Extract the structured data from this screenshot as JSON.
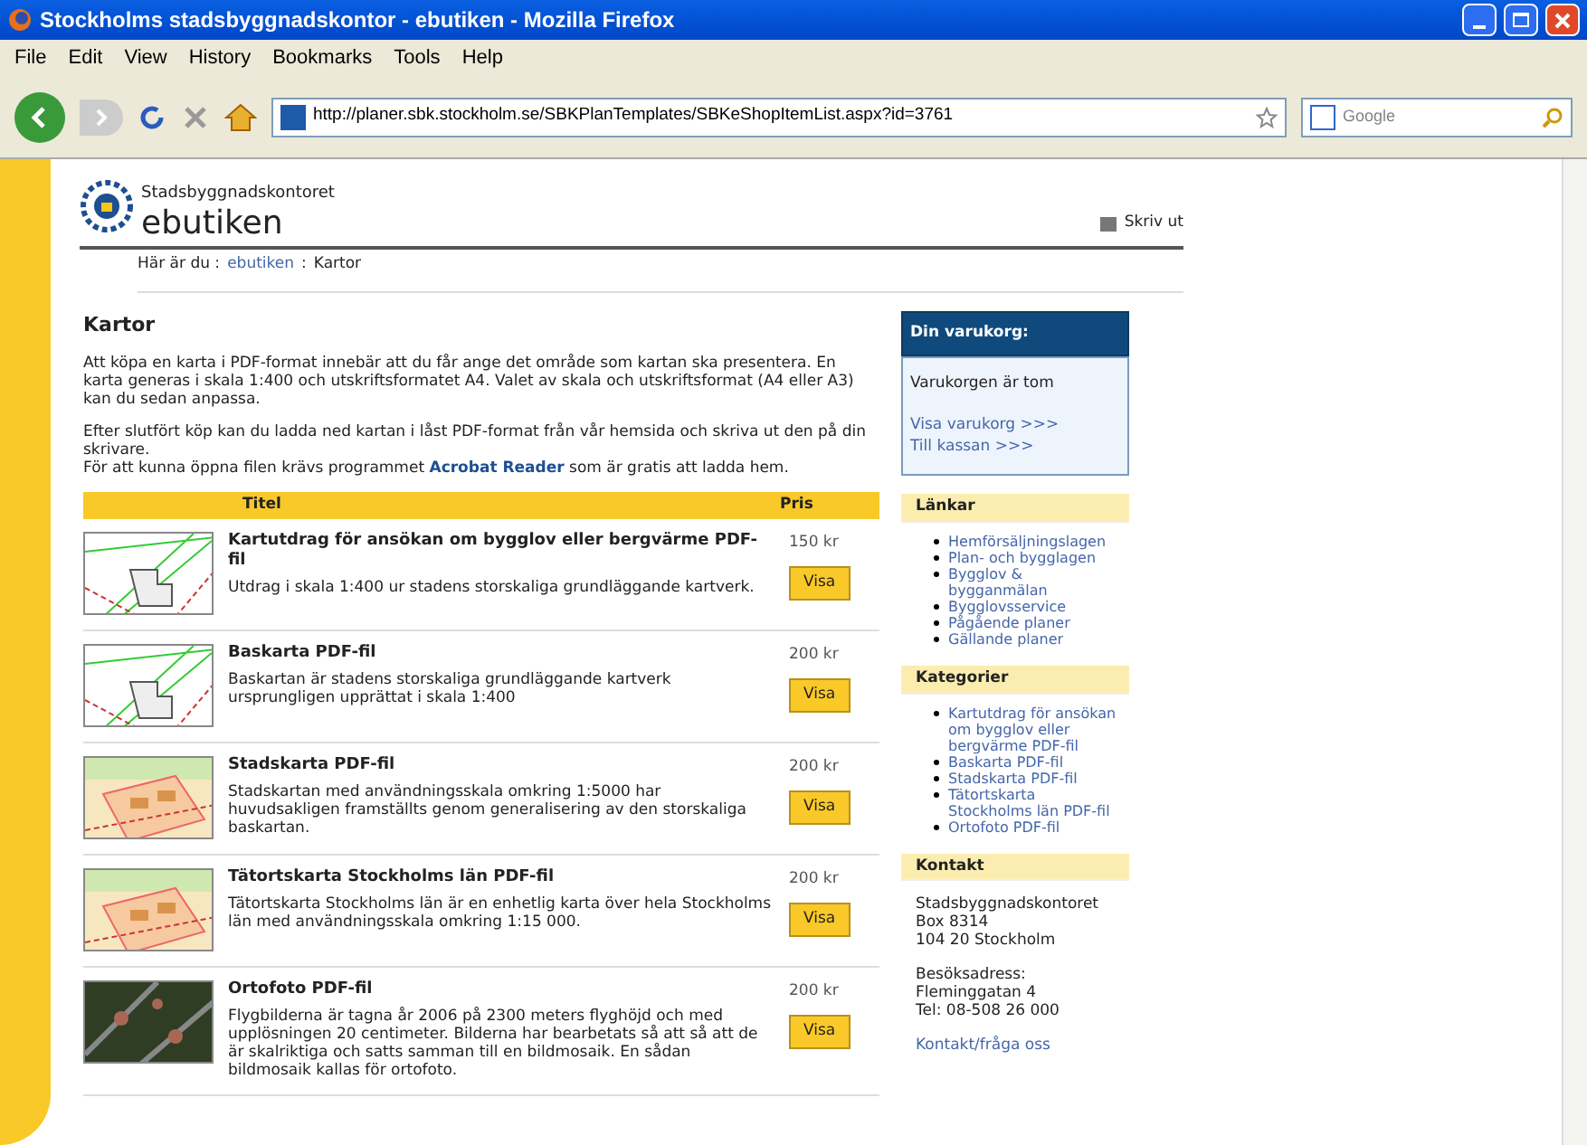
{
  "window": {
    "title": "Stockholms stadsbyggnadskontor - ebutiken - Mozilla Firefox"
  },
  "menu": [
    "File",
    "Edit",
    "View",
    "History",
    "Bookmarks",
    "Tools",
    "Help"
  ],
  "toolbar": {
    "url": "http://planer.sbk.stockholm.se/SBKPlanTemplates/SBKeShopItemList.aspx?id=3761",
    "search_placeholder": "Google"
  },
  "header": {
    "org": "Stadsbyggnadskontoret",
    "title": "ebutiken",
    "print": "Skriv ut"
  },
  "breadcrumb": {
    "label": "Här är du :",
    "link": "ebutiken",
    "separator": ":",
    "current": "Kartor"
  },
  "main": {
    "heading": "Kartor",
    "paragraph_1": "Att köpa en karta i PDF-format innebär att du får ange det område som kartan ska presentera. En karta generas i skala 1:400 och utskriftsformatet A4. Valet av skala och utskriftsformat (A4 eller A3) kan du sedan anpassa.",
    "paragraph_2": "Efter slutfört köp kan du ladda ned kartan i låst PDF-format från vår hemsida och skriva ut den på din skrivare.",
    "paragraph_3": {
      "before": "För att kunna öppna filen krävs programmet",
      "link": "Acrobat Reader",
      "after": "som är gratis att ladda hem."
    }
  },
  "table": {
    "columns": [
      "Titel",
      "Pris"
    ],
    "rows": [
      {
        "kind": "line-map",
        "title": "Kartutdrag för ansökan om bygglov eller bergvärme PDF-fil",
        "description": "Utdrag i skala 1:400 ur stadens storskaliga grundläggande kartverk.",
        "price": "150 kr",
        "button": "Visa"
      },
      {
        "kind": "line-map",
        "title": "Baskarta PDF-fil",
        "description": "Baskartan är stadens storskaliga grundläggande kartverk ursprungligen upprättat i skala 1:400",
        "price": "200 kr",
        "button": "Visa"
      },
      {
        "kind": "color-map",
        "title": "Stadskarta PDF-fil",
        "description": "Stadskartan med användningsskala omkring 1:5000 har huvudsakligen framställts genom generalisering av den storskaliga baskartan.",
        "price": "200 kr",
        "button": "Visa"
      },
      {
        "kind": "color-map",
        "title": "Tätortskarta Stockholms län PDF-fil",
        "description": "Tätortskarta Stockholms län är en enhetlig karta över hela Stockholms län med användningsskala omkring 1:15 000.",
        "price": "200 kr",
        "button": "Visa"
      },
      {
        "kind": "aerial-photo",
        "title": "Ortofoto PDF-fil",
        "description": "Flygbilderna är tagna år 2006 på 2300 meters flyghöjd och med upplösningen 20 centimeter. Bilderna har bearbetats så att så att de är skalriktiga och satts samman till en bildmosaik. En sådan bildmosaik kallas för ortofoto.",
        "price": "200 kr",
        "button": "Visa"
      }
    ]
  },
  "cart": {
    "title": "Din varukorg:",
    "status": "Varukorgen är tom",
    "links": [
      "Visa varukorg >>>",
      "Till kassan >>>"
    ]
  },
  "sidebar": [
    {
      "kind": "links",
      "heading": "Länkar",
      "items": [
        "Hemförsäljningslagen",
        "Plan- och bygglagen",
        "Bygglov & bygganmälan",
        "Bygglovsservice",
        "Pågående planer",
        "Gällande planer"
      ]
    },
    {
      "kind": "links",
      "heading": "Kategorier",
      "items": [
        "Kartutdrag för ansökan om bygglov eller bergvärme PDF-fil",
        "Baskarta PDF-fil",
        "Stadskarta PDF-fil",
        "Tätortskarta Stockholms län PDF-fil",
        "Ortofoto PDF-fil"
      ]
    },
    {
      "kind": "contact",
      "heading": "Kontakt",
      "blocks": [
        [
          "Stadsbyggnadskontoret",
          "Box 8314",
          "104 20 Stockholm"
        ],
        [
          "Besöksadress:",
          "Fleminggatan 4",
          "Tel: 08-508 26 000"
        ]
      ],
      "link": "Kontakt/fråga oss"
    }
  ]
}
